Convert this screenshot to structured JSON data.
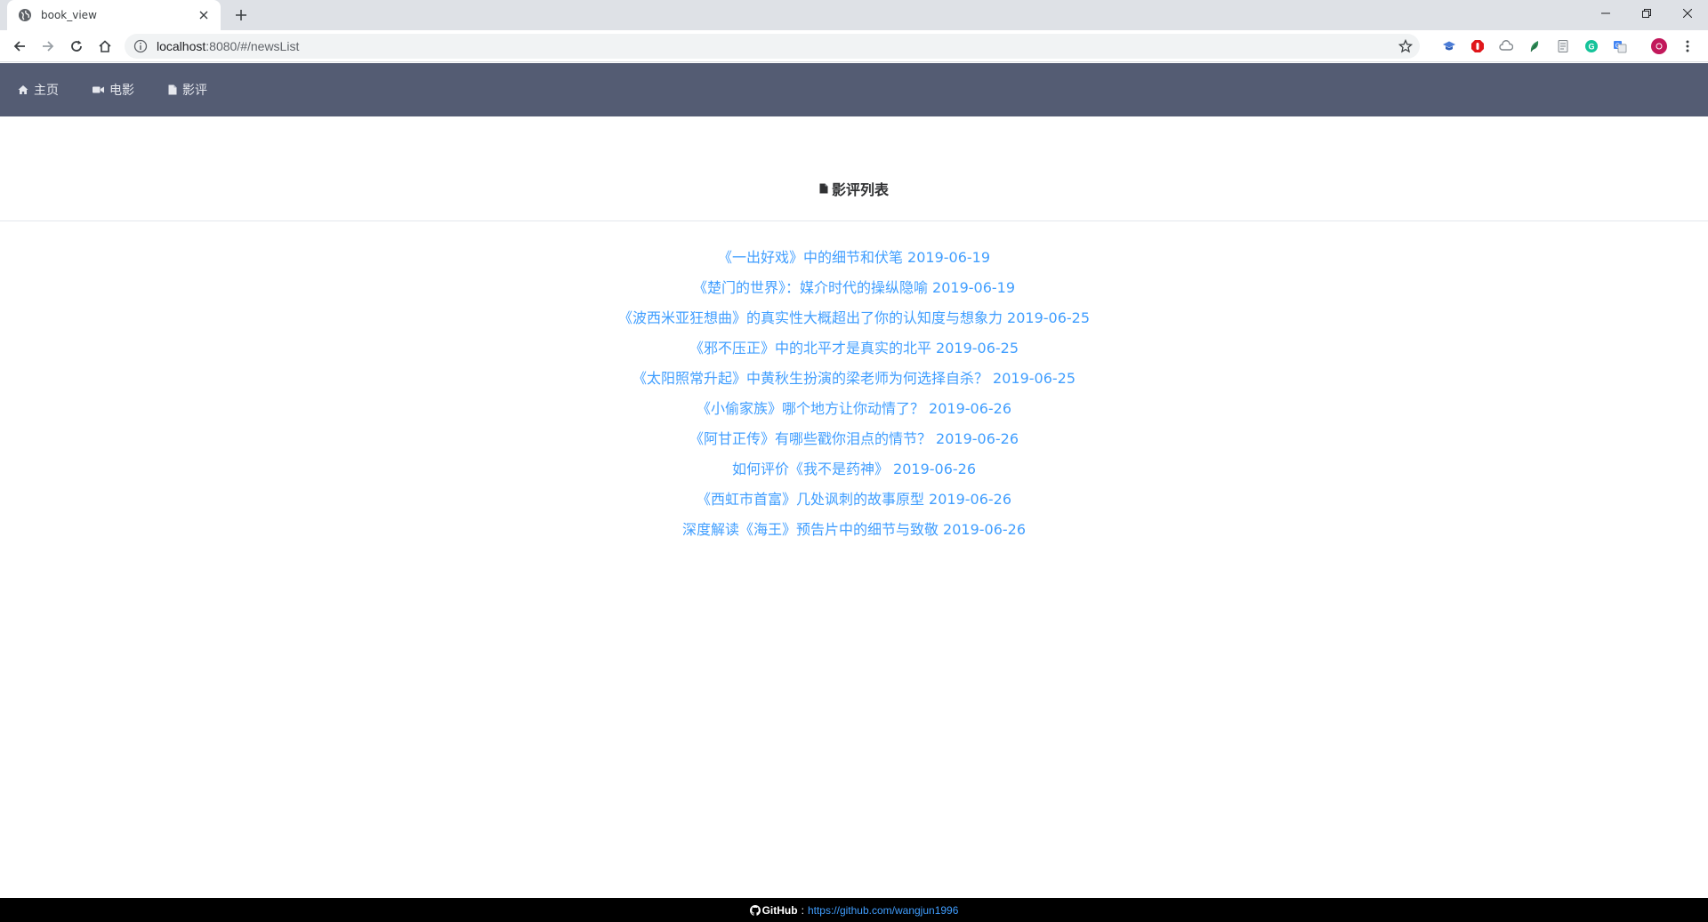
{
  "browser": {
    "tab_title": "book_view",
    "url_host": "localhost",
    "url_rest": ":8080/#/newsList"
  },
  "nav": {
    "items": [
      {
        "label": "主页",
        "icon": "home-icon"
      },
      {
        "label": "电影",
        "icon": "video-camera-icon"
      },
      {
        "label": "影评",
        "icon": "document-icon"
      }
    ]
  },
  "page": {
    "heading": "影评列表"
  },
  "news": [
    "《一出好戏》中的细节和伏笔 2019-06-19",
    "《楚门的世界》：媒介时代的操纵隐喻 2019-06-19",
    "《波西米亚狂想曲》的真实性大概超出了你的认知度与想象力 2019-06-25",
    "《邪不压正》中的北平才是真实的北平 2019-06-25",
    "《太阳照常升起》中黄秋生扮演的梁老师为何选择自杀？ 2019-06-25",
    "《小偷家族》哪个地方让你动情了？ 2019-06-26",
    "《阿甘正传》有哪些戳你泪点的情节？ 2019-06-26",
    "如何评价《我不是药神》 2019-06-26",
    "《西虹市首富》几处讽刺的故事原型 2019-06-26",
    "深度解读《海王》预告片中的细节与致敬 2019-06-26"
  ],
  "footer": {
    "label": "GitHub",
    "separator": ":",
    "link": "https://github.com/wangjun1996"
  },
  "colors": {
    "nav_bg": "#545c73",
    "link": "#409eff",
    "footer_bg": "#000000"
  }
}
